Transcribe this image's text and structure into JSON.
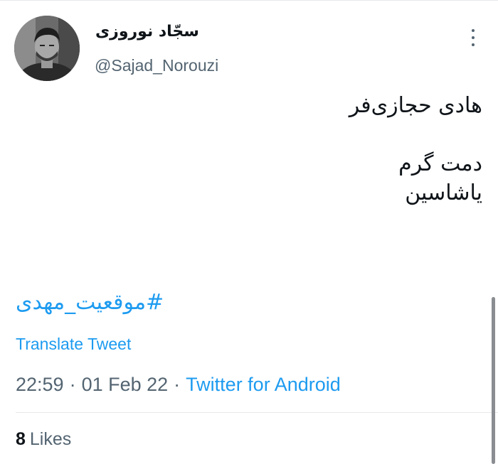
{
  "tweet": {
    "author": {
      "display_name": "سجّاد نوروزی",
      "handle": "@Sajad_Norouzi",
      "avatar_icon": "avatar-photo"
    },
    "more_icon": "more-vertical-icon",
    "text_lines": [
      "هادی حجازی‌فر",
      "",
      "دمت گرم",
      "یاشاسین"
    ],
    "hashtag": "#موقعیت_مهدی",
    "translate_label": "Translate Tweet",
    "time": "22:59",
    "separator": "·",
    "date": "01 Feb 22",
    "source": "Twitter for Android",
    "likes_count": "8",
    "likes_label": "Likes"
  },
  "colors": {
    "link": "#1d9bf0",
    "secondary_text": "#536471",
    "primary_text": "#0f1419",
    "divider": "#e7e9ea"
  }
}
